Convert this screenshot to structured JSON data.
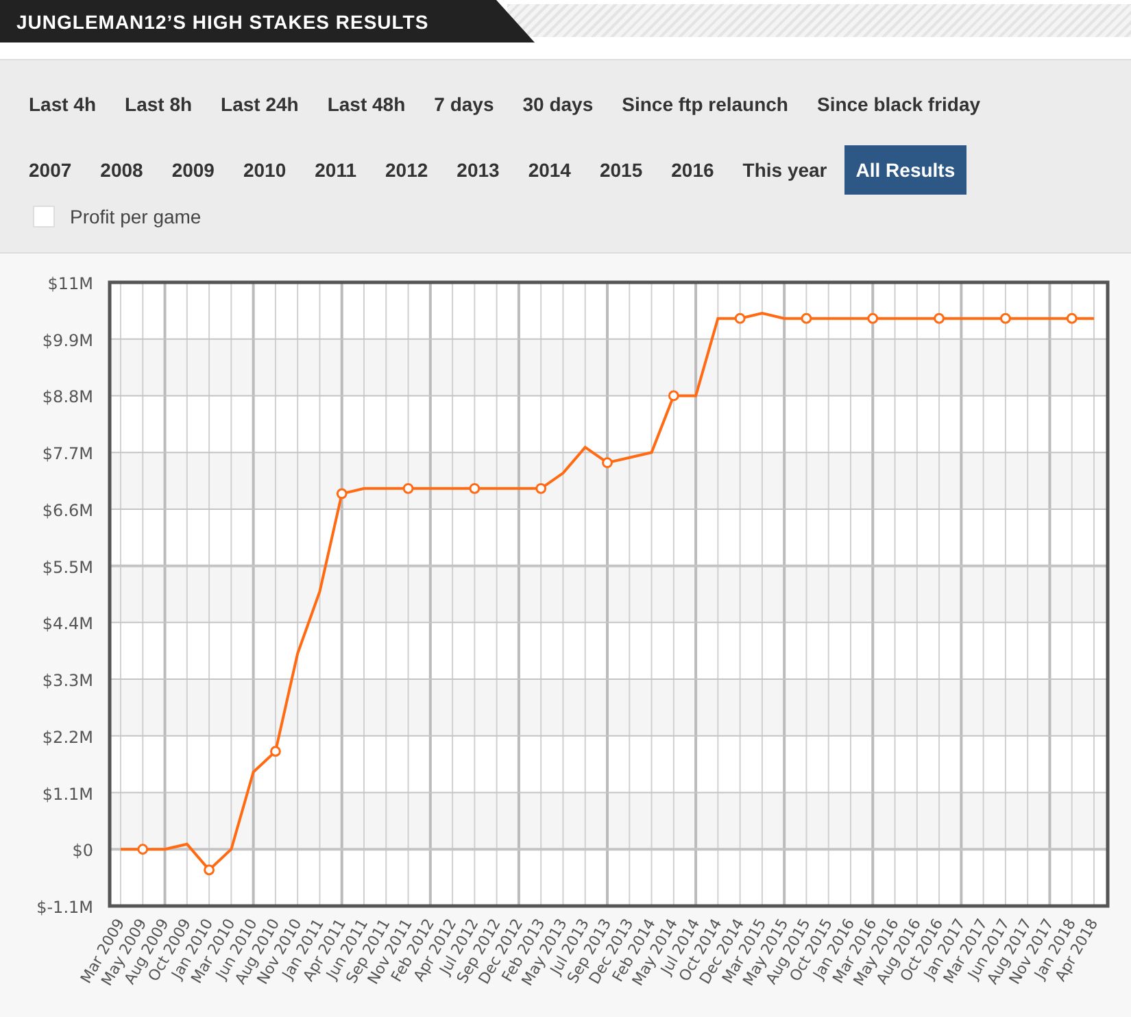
{
  "header": {
    "title": "JUNGLEMAN12’S HIGH STAKES RESULTS"
  },
  "filter_rows": [
    {
      "items": [
        {
          "label": "Last 4h",
          "selected": false
        },
        {
          "label": "Last 8h",
          "selected": false
        },
        {
          "label": "Last 24h",
          "selected": false
        },
        {
          "label": "Last 48h",
          "selected": false
        },
        {
          "label": "7 days",
          "selected": false
        },
        {
          "label": "30 days",
          "selected": false
        },
        {
          "label": "Since ftp relaunch",
          "selected": false
        },
        {
          "label": "Since black friday",
          "selected": false
        }
      ]
    },
    {
      "items": [
        {
          "label": "2007",
          "selected": false
        },
        {
          "label": "2008",
          "selected": false
        },
        {
          "label": "2009",
          "selected": false
        },
        {
          "label": "2010",
          "selected": false
        },
        {
          "label": "2011",
          "selected": false
        },
        {
          "label": "2012",
          "selected": false
        },
        {
          "label": "2013",
          "selected": false
        },
        {
          "label": "2014",
          "selected": false
        },
        {
          "label": "2015",
          "selected": false
        },
        {
          "label": "2016",
          "selected": false
        },
        {
          "label": "This year",
          "selected": false
        },
        {
          "label": "All Results",
          "selected": true
        }
      ]
    }
  ],
  "profit_per_game": {
    "label": "Profit per game",
    "checked": false
  },
  "chart": {
    "chart_data": {
      "type": "line",
      "grid": true,
      "categories": [
        "Mar 2009",
        "May 2009",
        "Aug 2009",
        "Oct 2009",
        "Jan 2010",
        "Mar 2010",
        "Jun 2010",
        "Aug 2010",
        "Nov 2010",
        "Jan 2011",
        "Apr 2011",
        "Jun 2011",
        "Sep 2011",
        "Nov 2011",
        "Feb 2012",
        "Apr 2012",
        "Jul 2012",
        "Sep 2012",
        "Dec 2012",
        "Feb 2013",
        "May 2013",
        "Jul 2013",
        "Sep 2013",
        "Dec 2013",
        "Feb 2014",
        "May 2014",
        "Jul 2014",
        "Oct 2014",
        "Dec 2014",
        "Mar 2015",
        "May 2015",
        "Aug 2015",
        "Oct 2015",
        "Jan 2016",
        "Mar 2016",
        "May 2016",
        "Aug 2016",
        "Oct 2016",
        "Jan 2017",
        "Mar 2017",
        "Jun 2017",
        "Aug 2017",
        "Nov 2017",
        "Jan 2018",
        "Apr 2018"
      ],
      "values": [
        0,
        0,
        0,
        0.1,
        -0.4,
        0,
        1.5,
        1.9,
        3.8,
        5.0,
        6.9,
        7.0,
        7.0,
        7.0,
        7.0,
        7.0,
        7.0,
        7.0,
        7.0,
        7.0,
        7.3,
        7.8,
        7.5,
        7.6,
        7.7,
        8.8,
        8.8,
        10.3,
        10.3,
        10.4,
        10.3,
        10.3,
        10.3,
        10.3,
        10.3,
        10.3,
        10.3,
        10.3,
        10.3,
        10.3,
        10.3,
        10.3,
        10.3,
        10.3,
        10.3
      ],
      "ylim": [
        -1.1,
        11
      ],
      "yticks": [
        {
          "value": 11,
          "label": "$11M"
        },
        {
          "value": 9.9,
          "label": "$9.9M"
        },
        {
          "value": 8.8,
          "label": "$8.8M"
        },
        {
          "value": 7.7,
          "label": "$7.7M"
        },
        {
          "value": 6.6,
          "label": "$6.6M"
        },
        {
          "value": 5.5,
          "label": "$5.5M"
        },
        {
          "value": 4.4,
          "label": "$4.4M"
        },
        {
          "value": 3.3,
          "label": "$3.3M"
        },
        {
          "value": 2.2,
          "label": "$2.2M"
        },
        {
          "value": 1.1,
          "label": "$1.1M"
        },
        {
          "value": 0,
          "label": "$0"
        },
        {
          "value": -1.1,
          "label": "$-1.1M"
        }
      ]
    }
  }
}
